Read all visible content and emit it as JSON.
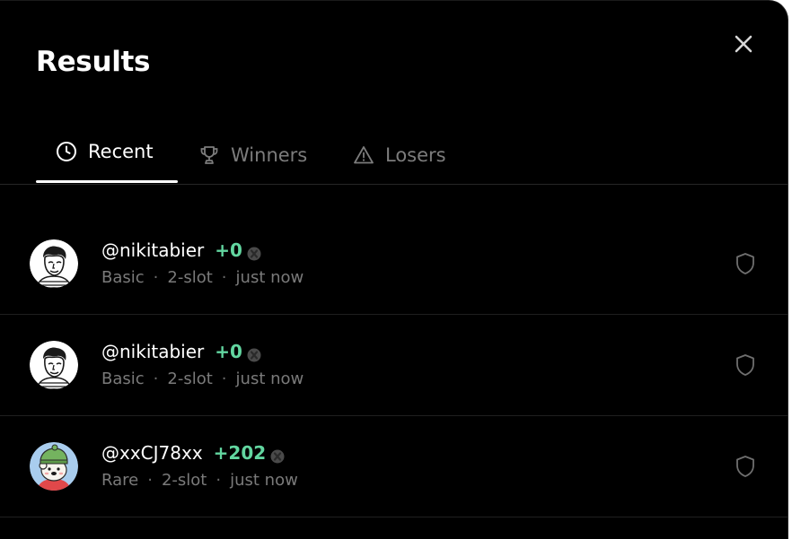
{
  "dialog": {
    "title": "Results"
  },
  "tabs": [
    {
      "label": "Recent",
      "icon": "clock-icon",
      "active": true
    },
    {
      "label": "Winners",
      "icon": "trophy-icon",
      "active": false
    },
    {
      "label": "Losers",
      "icon": "warning-icon",
      "active": false
    }
  ],
  "results": [
    {
      "username": "@nikitabier",
      "score": "+0",
      "tier": "Basic",
      "slots": "2-slot",
      "time": "just now",
      "avatar": "sketch-portrait-avatar",
      "separator": "·"
    },
    {
      "username": "@nikitabier",
      "score": "+0",
      "tier": "Basic",
      "slots": "2-slot",
      "time": "just now",
      "avatar": "sketch-portrait-avatar",
      "separator": "·"
    },
    {
      "username": "@xxCJ78xx",
      "score": "+202",
      "tier": "Rare",
      "slots": "2-slot",
      "time": "just now",
      "avatar": "bear-with-beanie-avatar",
      "separator": "·"
    }
  ],
  "colors": {
    "background": "#000000",
    "score_positive": "#62d6a0",
    "muted_text": "#7a7a7a",
    "active_text": "#ffffff"
  }
}
